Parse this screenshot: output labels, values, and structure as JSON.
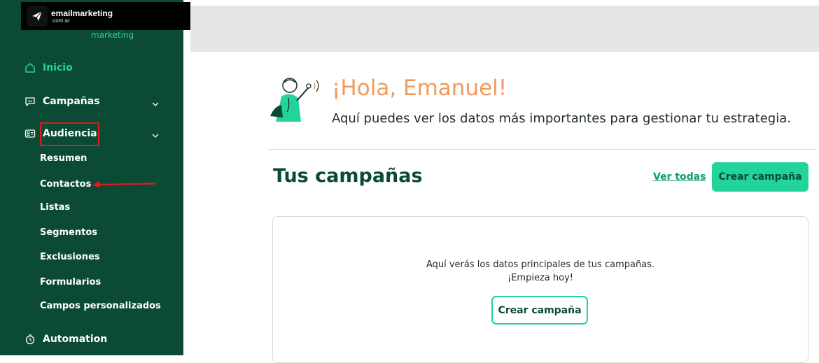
{
  "brand": {
    "name": "emailmarketing",
    "domain": ".com.ar",
    "tagline": "marketing"
  },
  "sidebar": {
    "items": [
      {
        "label": "Inicio",
        "icon": "home-icon"
      },
      {
        "label": "Campañas",
        "icon": "chat-icon"
      },
      {
        "label": "Audiencia",
        "icon": "contact-card-icon"
      },
      {
        "label": "Automation",
        "icon": "automation-icon"
      }
    ],
    "audiencia_sub": [
      "Resumen",
      "Contactos",
      "Listas",
      "Segmentos",
      "Exclusiones",
      "Formularios",
      "Campos personalizados"
    ]
  },
  "main": {
    "greeting": "¡Hola, Emanuel!",
    "subtitle": "Aquí puedes ver los datos más importantes para gestionar tu estrategia.",
    "section_title": "Tus campañas",
    "ver_todas": "Ver todas",
    "crear_campana": "Crear campaña",
    "empty_line1": "Aquí verás los datos principales de tus campañas.",
    "empty_line2": "¡Empieza hoy!",
    "card_button": "Crear campaña"
  },
  "colors": {
    "sidebar_bg": "#0b4a34",
    "accent": "#22d49c",
    "greeting": "#f29a5c",
    "annotation": "#e11b1b"
  }
}
